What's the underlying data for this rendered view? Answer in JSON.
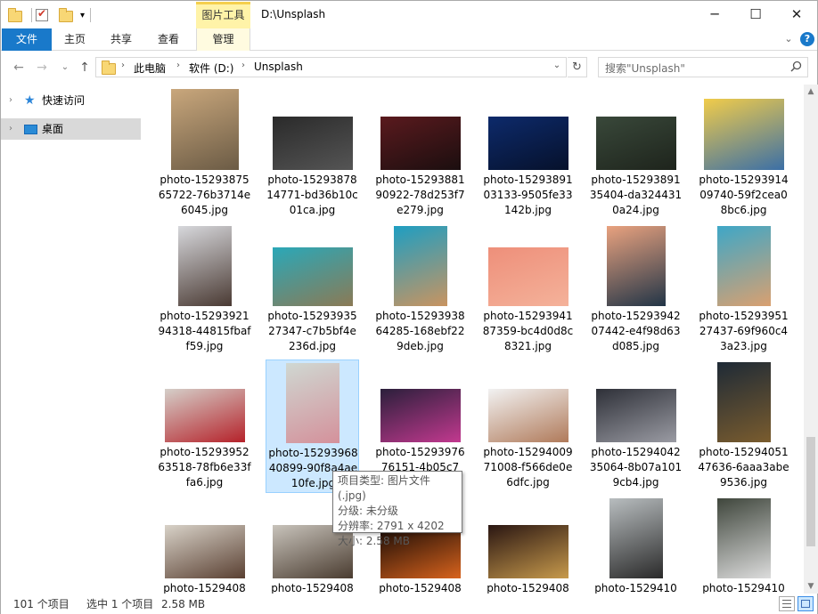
{
  "window": {
    "title": "D:\\Unsplash",
    "context_tab_group": "图片工具",
    "controls": {
      "minimize": "─",
      "maximize": "☐",
      "close": "✕"
    }
  },
  "ribbon": {
    "tabs": [
      {
        "label": "文件"
      },
      {
        "label": "主页"
      },
      {
        "label": "共享"
      },
      {
        "label": "查看"
      },
      {
        "label": "管理"
      }
    ],
    "expand_glyph": "⌄",
    "help_glyph": "?"
  },
  "nav_buttons": {
    "back": "←",
    "forward": "→",
    "recent": "⌄",
    "up": "↑"
  },
  "address": {
    "crumbs": [
      "此电脑",
      "软件 (D:)",
      "Unsplash"
    ],
    "separator": "›",
    "dropdown": "⌄",
    "refresh": "↻"
  },
  "search": {
    "placeholder": "搜索\"Unsplash\""
  },
  "nav_pane": {
    "items": [
      {
        "label": "快速访问",
        "icon": "star-icon",
        "chevron": "›"
      },
      {
        "label": "桌面",
        "icon": "desktop-icon",
        "chevron": "›"
      }
    ]
  },
  "files": [
    {
      "name": "photo-1529387565722-76b3714e6045.jpg",
      "colors": [
        "#c9a77c",
        "#6b5b45"
      ]
    },
    {
      "name": "photo-1529387814771-bd36b10c01ca.jpg",
      "colors": [
        "#2a2a2a",
        "#555555"
      ]
    },
    {
      "name": "photo-1529388190922-78d253f7e279.jpg",
      "colors": [
        "#5a1a1e",
        "#1b0e0f"
      ]
    },
    {
      "name": "photo-1529389103133-9505fe33142b.jpg",
      "colors": [
        "#0d2a6b",
        "#06112b"
      ]
    },
    {
      "name": "photo-1529389135404-da3244310a24.jpg",
      "colors": [
        "#39483a",
        "#1e241c"
      ]
    },
    {
      "name": "photo-1529391409740-59f2cea08bc6.jpg",
      "colors": [
        "#f1cc4a",
        "#3b6fa6"
      ]
    },
    {
      "name": "photo-1529392194318-44815fbaff59.jpg",
      "colors": [
        "#d7d8dc",
        "#4a3a33"
      ]
    },
    {
      "name": "photo-1529393527347-c7b5bf4e236d.jpg",
      "colors": [
        "#2aa8b8",
        "#8b7a55"
      ]
    },
    {
      "name": "photo-1529393864285-168ebf229deb.jpg",
      "colors": [
        "#1e9ec2",
        "#c99460"
      ]
    },
    {
      "name": "photo-1529394187359-bc4d0d8c8321.jpg",
      "colors": [
        "#ee8f7a",
        "#f4b29a"
      ]
    },
    {
      "name": "photo-1529394207442-e4f98d63d085.jpg",
      "colors": [
        "#e9a27f",
        "#223547"
      ]
    },
    {
      "name": "photo-1529395127437-69f960c43a23.jpg",
      "colors": [
        "#3ea7c7",
        "#d9a070"
      ]
    },
    {
      "name": "photo-1529395263518-78fb6e33ffa6.jpg",
      "colors": [
        "#d5cfc9",
        "#b5222a"
      ]
    },
    {
      "name": "photo-1529396840899-90f8a4ae10fe.jpg",
      "colors": [
        "#cfd8d2",
        "#d4919b"
      ]
    },
    {
      "name": "photo-1529397676151-4b05c7",
      "colors": [
        "#2b1f3b",
        "#c2398f"
      ]
    },
    {
      "name": "photo-1529400971008-f566de0e6dfc.jpg",
      "colors": [
        "#f2f2f2",
        "#b07a5a"
      ]
    },
    {
      "name": "photo-1529404235064-8b07a1019cb4.jpg",
      "colors": [
        "#2e3038",
        "#9a9ba3"
      ]
    },
    {
      "name": "photo-1529405147636-6aaa3abe9536.jpg",
      "colors": [
        "#1e2a36",
        "#7a5c2e"
      ]
    },
    {
      "name": "photo-1529408",
      "colors": [
        "#d8d2c8",
        "#5a4032"
      ]
    },
    {
      "name": "photo-1529408",
      "colors": [
        "#c8c3bb",
        "#4a3c30"
      ]
    },
    {
      "name": "photo-1529408",
      "colors": [
        "#120805",
        "#d8631d"
      ]
    },
    {
      "name": "photo-1529408",
      "colors": [
        "#2a1612",
        "#c79a4c"
      ]
    },
    {
      "name": "photo-1529410",
      "colors": [
        "#b8bdbf",
        "#2a2a2a"
      ]
    },
    {
      "name": "photo-1529410",
      "colors": [
        "#3f463c",
        "#dcdcdc"
      ]
    }
  ],
  "tooltip": {
    "lines": [
      "项目类型: 图片文件(.jpg)",
      "分级: 未分级",
      "分辨率: 2791 x 4202",
      "大小: 2.58 MB"
    ]
  },
  "status": {
    "count": "101 个项目",
    "selected": "选中 1 个项目",
    "size": "2.58 MB"
  },
  "colors": {
    "accent": "#1979ca",
    "selection": "#cce8ff",
    "context_tab": "#fff3a8"
  }
}
